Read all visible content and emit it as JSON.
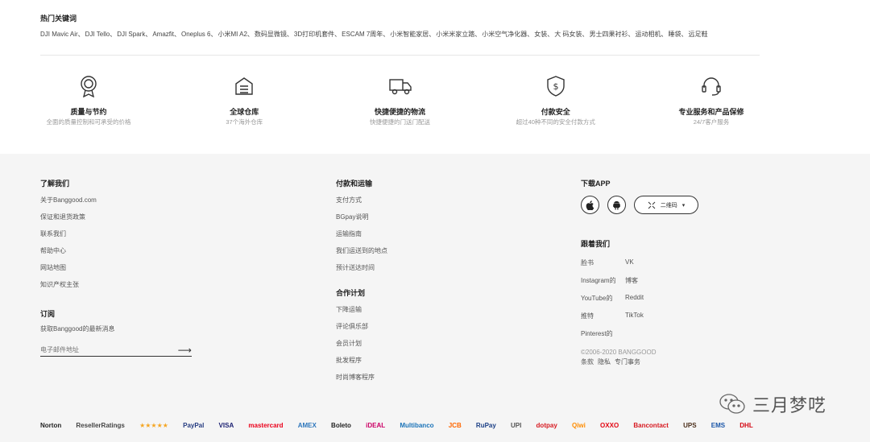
{
  "hot": {
    "title": "热门关键词",
    "keywords": [
      "DJI Mavic Air、",
      "DJI Tello、",
      "DJI Spark、",
      "Amazfit、",
      "Oneplus 6、",
      "小米MI A2、",
      "数码显微镜、",
      "3D打印机套件、",
      "ESCAM 7周年、",
      "小米智能家居、",
      "小米米家立踏、",
      "小米空气净化器、",
      "女装、",
      "大 码女装、",
      "男士四果衬衫、",
      "运动相机、",
      "睡袋、",
      "远足鞋"
    ]
  },
  "features": [
    {
      "icon": "medal-icon",
      "title": "质量与节约",
      "desc": "全面的质量控制和可承受的价格"
    },
    {
      "icon": "warehouse-icon",
      "title": "全球仓库",
      "desc": "37个海外仓库"
    },
    {
      "icon": "truck-icon",
      "title": "快捷便捷的物流",
      "desc": "快捷便捷的门送门配送"
    },
    {
      "icon": "shield-dollar-icon",
      "title": "付款安全",
      "desc": "超过40种不同的安全付款方式"
    },
    {
      "icon": "headset-icon",
      "title": "专业服务和产品保修",
      "desc": "24/7客户服务"
    }
  ],
  "about": {
    "title": "了解我们",
    "items": [
      "关于Banggood.com",
      "保证和退货政策",
      "联系我们",
      "帮助中心",
      "网站地图",
      "知识产权主张"
    ]
  },
  "subscribe": {
    "title": "订阅",
    "desc": "获取Banggood的最新消息",
    "placeholder": "电子邮件地址",
    "arrow": "⟶"
  },
  "payship": {
    "title": "付款和运输",
    "items": [
      "支付方式",
      "BGpay说明",
      "运输指南",
      "我们运送到的地点",
      "预计送达时间"
    ]
  },
  "cooperation": {
    "title": "合作计划",
    "items": [
      "下降运输",
      "评论俱乐部",
      "会员计划",
      "批发程序",
      "时尚博客程序"
    ]
  },
  "app": {
    "title": "下载APP",
    "apple_icon": "apple-icon",
    "android_icon": "android-icon",
    "qr_label": "二维码",
    "qr_caret": "▾"
  },
  "follow": {
    "title": "跟着我们",
    "items": [
      "脸书",
      "VK",
      "Instagram的",
      "博客",
      "YouTube的",
      "Reddit",
      "推特",
      "TikTok",
      "Pinterest的"
    ]
  },
  "copyright": "©2006-2020 BANGGOOD",
  "legal": [
    "条款",
    "隐私",
    "专门事务"
  ],
  "watermark": "三月梦呓",
  "payments": [
    {
      "label": "Norton",
      "color": "#222"
    },
    {
      "label": "ResellerRatings",
      "color": "#444"
    },
    {
      "label": "★★★★★",
      "color": "#f5a623"
    },
    {
      "label": "PayPal",
      "color": "#253b80"
    },
    {
      "label": "VISA",
      "color": "#1a1f71"
    },
    {
      "label": "mastercard",
      "color": "#eb001b"
    },
    {
      "label": "AMEX",
      "color": "#2e77bc"
    },
    {
      "label": "Boleto",
      "color": "#222"
    },
    {
      "label": "iDEAL",
      "color": "#cc0066"
    },
    {
      "label": "Multibanco",
      "color": "#1a73b8"
    },
    {
      "label": "JCB",
      "color": "#ff6600"
    },
    {
      "label": "RuPay",
      "color": "#1a3e85"
    },
    {
      "label": "UPI",
      "color": "#555"
    },
    {
      "label": "dotpay",
      "color": "#d71920"
    },
    {
      "label": "Qiwi",
      "color": "#ff8c00"
    },
    {
      "label": "OXXO",
      "color": "#e30613"
    },
    {
      "label": "Bancontact",
      "color": "#d71920"
    },
    {
      "label": "UPS",
      "color": "#4b2e1a"
    },
    {
      "label": "EMS",
      "color": "#1a56a8"
    },
    {
      "label": "DHL",
      "color": "#d40511"
    }
  ]
}
